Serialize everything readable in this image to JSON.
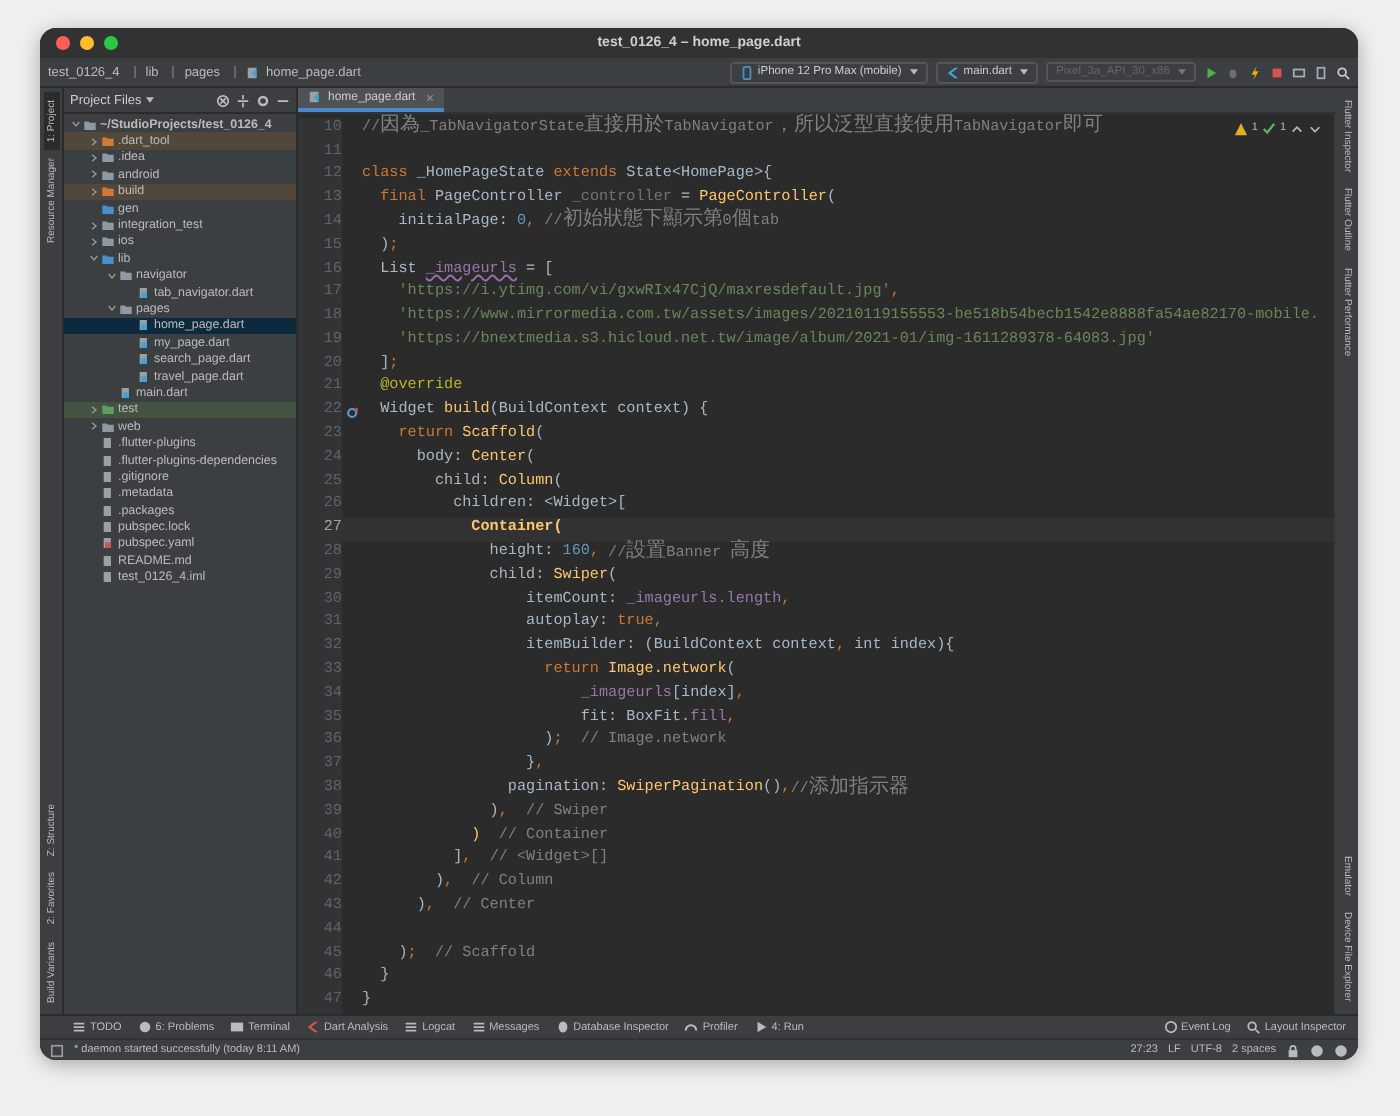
{
  "window": {
    "title": "test_0126_4 – home_page.dart"
  },
  "navbar": {
    "breadcrumbs": [
      "test_0126_4",
      "lib",
      "pages",
      "home_page.dart"
    ],
    "device": "iPhone 12 Pro Max (mobile)",
    "config": "main.dart",
    "emulator": {
      "label": "Pixel_3a_API_30_x86",
      "disabled": true
    }
  },
  "left_strip": [
    {
      "label": "1: Project",
      "selected": true
    },
    {
      "label": "Resource Manager",
      "selected": false
    }
  ],
  "left_strip_bottom": [
    {
      "label": "Z: Structure",
      "selected": false
    },
    {
      "label": "2: Favorites",
      "selected": false
    },
    {
      "label": "Build Variants",
      "selected": false
    }
  ],
  "right_strip": [
    {
      "label": "Flutter Inspector",
      "selected": false
    },
    {
      "label": "Flutter Outline",
      "selected": false
    },
    {
      "label": "Flutter Performance",
      "selected": false
    }
  ],
  "right_strip_bottom": [
    {
      "label": "Emulator",
      "selected": false
    },
    {
      "label": "Device File Explorer",
      "selected": false
    }
  ],
  "project": {
    "view": "Project Files",
    "tree": [
      {
        "label": "~/StudioProjects/test_0126_4",
        "kind": "module",
        "expanded": true,
        "selected": false,
        "children": [
          {
            "label": ".dart_tool",
            "kind": "excluded",
            "expanded": false,
            "selected": false
          },
          {
            "label": ".idea",
            "kind": "folder",
            "expanded": false,
            "selected": false
          },
          {
            "label": "android",
            "kind": "folder",
            "expanded": false,
            "selected": false
          },
          {
            "label": "build",
            "kind": "excluded",
            "expanded": false,
            "selected": false
          },
          {
            "label": "gen",
            "kind": "gen",
            "selected": false
          },
          {
            "label": "integration_test",
            "kind": "folder",
            "expanded": false,
            "selected": false
          },
          {
            "label": "ios",
            "kind": "folder",
            "expanded": false,
            "selected": false
          },
          {
            "label": "lib",
            "kind": "source",
            "expanded": true,
            "selected": false,
            "children": [
              {
                "label": "navigator",
                "kind": "folder",
                "expanded": true,
                "selected": false,
                "children": [
                  {
                    "label": "tab_navigator.dart",
                    "kind": "dart",
                    "selected": false
                  }
                ]
              },
              {
                "label": "pages",
                "kind": "folder",
                "expanded": true,
                "selected": false,
                "children": [
                  {
                    "label": "home_page.dart",
                    "kind": "dart",
                    "selected": true
                  },
                  {
                    "label": "my_page.dart",
                    "kind": "dart",
                    "selected": false
                  },
                  {
                    "label": "search_page.dart",
                    "kind": "dart",
                    "selected": false
                  },
                  {
                    "label": "travel_page.dart",
                    "kind": "dart",
                    "selected": false
                  }
                ]
              },
              {
                "label": "main.dart",
                "kind": "dart",
                "selected": false
              }
            ]
          },
          {
            "label": "test",
            "kind": "test",
            "expanded": false,
            "selected": false
          },
          {
            "label": "web",
            "kind": "folder",
            "expanded": false,
            "selected": false
          },
          {
            "label": ".flutter-plugins",
            "kind": "file",
            "selected": false
          },
          {
            "label": ".flutter-plugins-dependencies",
            "kind": "file",
            "selected": false
          },
          {
            "label": ".gitignore",
            "kind": "file",
            "selected": false
          },
          {
            "label": ".metadata",
            "kind": "file",
            "selected": false
          },
          {
            "label": ".packages",
            "kind": "file",
            "selected": false
          },
          {
            "label": "pubspec.lock",
            "kind": "file",
            "selected": false
          },
          {
            "label": "pubspec.yaml",
            "kind": "yaml",
            "selected": false
          },
          {
            "label": "README.md",
            "kind": "file",
            "selected": false
          },
          {
            "label": "test_0126_4.iml",
            "kind": "iml",
            "selected": false
          }
        ]
      }
    ]
  },
  "editor": {
    "tabs": [
      {
        "label": "home_page.dart",
        "selected": true
      }
    ],
    "inspections": {
      "warnings": "1",
      "weak": "1"
    },
    "lines": [
      {
        "number": "10",
        "current": false,
        "tokens": [
          {
            "kind": "cmt",
            "text": "//因為_TabNavigatorState直接用於TabNavigator，所以泛型直接使用TabNavigator即可"
          }
        ]
      },
      {
        "number": "11",
        "current": false
      },
      {
        "number": "12",
        "current": false,
        "tokens": [
          {
            "kind": "kw",
            "text": "class"
          },
          {
            "kind": "plain",
            "text": " _HomePageState "
          },
          {
            "kind": "kw",
            "text": "extends"
          },
          {
            "kind": "plain",
            "text": " State<HomePage>{"
          }
        ]
      },
      {
        "number": "13",
        "current": false,
        "tokens": [
          {
            "kind": "kw",
            "text": "  final"
          },
          {
            "kind": "plain",
            "text": " PageController "
          },
          {
            "kind": "unused",
            "text": "_controller"
          },
          {
            "kind": "plain",
            "text": " = "
          },
          {
            "kind": "fn",
            "text": "PageController"
          },
          {
            "kind": "plain",
            "text": "("
          }
        ]
      },
      {
        "number": "14",
        "current": false,
        "tokens": [
          {
            "kind": "plain",
            "text": "    initialPage: "
          },
          {
            "kind": "num",
            "text": "0"
          },
          {
            "kind": "kw",
            "text": ","
          },
          {
            "kind": "cmt",
            "text": " //初始狀態下顯示第0個tab"
          }
        ]
      },
      {
        "number": "15",
        "current": false,
        "tokens": [
          {
            "kind": "plain",
            "text": "  )"
          },
          {
            "kind": "kw",
            "text": ";"
          }
        ]
      },
      {
        "number": "16",
        "current": false,
        "tokens": [
          {
            "kind": "plain",
            "text": "  List "
          },
          {
            "kind": "field",
            "text": "_imageurls",
            "underline": true
          },
          {
            "kind": "plain",
            "text": " = ["
          }
        ]
      },
      {
        "number": "17",
        "current": false,
        "tokens": [
          {
            "kind": "str",
            "text": "    'https://i.ytimg.com/vi/gxwRIx47CjQ/maxresdefault.jpg'"
          },
          {
            "kind": "kw",
            "text": ","
          }
        ]
      },
      {
        "number": "18",
        "current": false,
        "tokens": [
          {
            "kind": "str",
            "text": "    'https://www.mirrormedia.com.tw/assets/images/20210119155553-be518b54becb1542e8888fa54ae82170-mobile."
          }
        ]
      },
      {
        "number": "19",
        "current": false,
        "tokens": [
          {
            "kind": "str",
            "text": "    'https://bnextmedia.s3.hicloud.net.tw/image/album/2021-01/img-1611289378-64083.jpg'"
          }
        ]
      },
      {
        "number": "20",
        "current": false,
        "tokens": [
          {
            "kind": "plain",
            "text": "  ]"
          },
          {
            "kind": "kw",
            "text": ";"
          }
        ]
      },
      {
        "number": "21",
        "current": false,
        "tokens": [
          {
            "kind": "ann",
            "text": "  @override"
          }
        ]
      },
      {
        "number": "22",
        "current": false,
        "override_marker": true,
        "tokens": [
          {
            "kind": "plain",
            "text": "  Widget "
          },
          {
            "kind": "fn",
            "text": "build"
          },
          {
            "kind": "plain",
            "text": "(BuildContext context) {"
          }
        ]
      },
      {
        "number": "23",
        "current": false,
        "tokens": [
          {
            "kind": "kw",
            "text": "    return "
          },
          {
            "kind": "fn",
            "text": "Scaffold"
          },
          {
            "kind": "plain",
            "text": "("
          }
        ]
      },
      {
        "number": "24",
        "current": false,
        "tokens": [
          {
            "kind": "plain",
            "text": "      body: "
          },
          {
            "kind": "fn",
            "text": "Center"
          },
          {
            "kind": "plain",
            "text": "("
          }
        ]
      },
      {
        "number": "25",
        "current": false,
        "tokens": [
          {
            "kind": "plain",
            "text": "        child: "
          },
          {
            "kind": "fn",
            "text": "Column"
          },
          {
            "kind": "plain",
            "text": "("
          }
        ]
      },
      {
        "number": "26",
        "current": false,
        "tokens": [
          {
            "kind": "plain",
            "text": "          children: <Widget>["
          }
        ]
      },
      {
        "number": "27",
        "current": true,
        "tokens": [
          {
            "kind": "fn",
            "text": "            Container("
          }
        ]
      },
      {
        "number": "28",
        "current": false,
        "tokens": [
          {
            "kind": "plain",
            "text": "              height: "
          },
          {
            "kind": "num",
            "text": "160"
          },
          {
            "kind": "kw",
            "text": ","
          },
          {
            "kind": "cmt",
            "text": " //設置Banner 高度"
          }
        ]
      },
      {
        "number": "29",
        "current": false,
        "tokens": [
          {
            "kind": "plain",
            "text": "              child: "
          },
          {
            "kind": "fn",
            "text": "Swiper"
          },
          {
            "kind": "plain",
            "text": "("
          }
        ]
      },
      {
        "number": "30",
        "current": false,
        "tokens": [
          {
            "kind": "plain",
            "text": "                  itemCount: "
          },
          {
            "kind": "field",
            "text": "_imageurls.length"
          },
          {
            "kind": "kw",
            "text": ","
          }
        ]
      },
      {
        "number": "31",
        "current": false,
        "tokens": [
          {
            "kind": "plain",
            "text": "                  autoplay: "
          },
          {
            "kind": "kw",
            "text": "true,"
          }
        ]
      },
      {
        "number": "32",
        "current": false,
        "tokens": [
          {
            "kind": "plain",
            "text": "                  itemBuilder: (BuildContext context"
          },
          {
            "kind": "kw",
            "text": ","
          },
          {
            "kind": "plain",
            "text": " int index){"
          }
        ]
      },
      {
        "number": "33",
        "current": false,
        "tokens": [
          {
            "kind": "kw",
            "text": "                    return "
          },
          {
            "kind": "fn",
            "text": "Image.network"
          },
          {
            "kind": "plain",
            "text": "("
          }
        ]
      },
      {
        "number": "34",
        "current": false,
        "tokens": [
          {
            "kind": "field",
            "text": "                        _imageurls"
          },
          {
            "kind": "plain",
            "text": "[index]"
          },
          {
            "kind": "kw",
            "text": ","
          }
        ]
      },
      {
        "number": "35",
        "current": false,
        "tokens": [
          {
            "kind": "plain",
            "text": "                        fit: BoxFit."
          },
          {
            "kind": "field",
            "text": "fill"
          },
          {
            "kind": "kw",
            "text": ","
          }
        ]
      },
      {
        "number": "36",
        "current": false,
        "tokens": [
          {
            "kind": "plain",
            "text": "                    )"
          },
          {
            "kind": "kw",
            "text": ";"
          },
          {
            "kind": "cmt",
            "text": "  // Image.network"
          }
        ]
      },
      {
        "number": "37",
        "current": false,
        "tokens": [
          {
            "kind": "plain",
            "text": "                  }"
          },
          {
            "kind": "kw",
            "text": ","
          }
        ]
      },
      {
        "number": "38",
        "current": false,
        "tokens": [
          {
            "kind": "plain",
            "text": "                pagination: "
          },
          {
            "kind": "fn",
            "text": "SwiperPagination"
          },
          {
            "kind": "plain",
            "text": "()"
          },
          {
            "kind": "kw",
            "text": ","
          },
          {
            "kind": "cmt",
            "text": "//添加指示器"
          }
        ]
      },
      {
        "number": "39",
        "current": false,
        "tokens": [
          {
            "kind": "plain",
            "text": "              )"
          },
          {
            "kind": "kw",
            "text": ","
          },
          {
            "kind": "cmt",
            "text": "  // Swiper"
          }
        ]
      },
      {
        "number": "40",
        "current": false,
        "tokens": [
          {
            "kind": "fn",
            "text": "            )"
          },
          {
            "kind": "cmt",
            "text": "  // Container"
          }
        ]
      },
      {
        "number": "41",
        "current": false,
        "tokens": [
          {
            "kind": "plain",
            "text": "          ]"
          },
          {
            "kind": "kw",
            "text": ","
          },
          {
            "kind": "cmt",
            "text": "  // <Widget>[]"
          }
        ]
      },
      {
        "number": "42",
        "current": false,
        "tokens": [
          {
            "kind": "plain",
            "text": "        )"
          },
          {
            "kind": "kw",
            "text": ","
          },
          {
            "kind": "cmt",
            "text": "  // Column"
          }
        ]
      },
      {
        "number": "43",
        "current": false,
        "tokens": [
          {
            "kind": "plain",
            "text": "      )"
          },
          {
            "kind": "kw",
            "text": ","
          },
          {
            "kind": "cmt",
            "text": "  // Center"
          }
        ]
      },
      {
        "number": "44",
        "current": false
      },
      {
        "number": "45",
        "current": false,
        "tokens": [
          {
            "kind": "plain",
            "text": "    )"
          },
          {
            "kind": "kw",
            "text": ";"
          },
          {
            "kind": "cmt",
            "text": "  // Scaffold"
          }
        ]
      },
      {
        "number": "46",
        "current": false,
        "tokens": [
          {
            "kind": "plain",
            "text": "  }"
          }
        ]
      },
      {
        "number": "47",
        "current": false,
        "tokens": [
          {
            "kind": "plain",
            "text": "}"
          }
        ]
      }
    ]
  },
  "tool_windows": [
    {
      "label": "TODO",
      "kind": "list"
    },
    {
      "label": "6: Problems",
      "kind": "info"
    },
    {
      "label": "Terminal",
      "kind": "terminal"
    },
    {
      "label": "Dart Analysis",
      "kind": "dart"
    },
    {
      "label": "Logcat",
      "kind": "list"
    },
    {
      "label": "Messages",
      "kind": "list"
    },
    {
      "label": "Database Inspector",
      "kind": "database"
    },
    {
      "label": "Profiler",
      "kind": "gauge"
    },
    {
      "label": "4: Run",
      "kind": "run"
    }
  ],
  "tool_windows_right": [
    {
      "label": "Event Log",
      "kind": "info"
    },
    {
      "label": "Layout Inspector",
      "kind": "search"
    }
  ],
  "status_bar": {
    "message": "* daemon started successfully (today 8:11 AM)",
    "items": [
      "27:23",
      "LF",
      "UTF-8",
      "2 spaces"
    ]
  }
}
